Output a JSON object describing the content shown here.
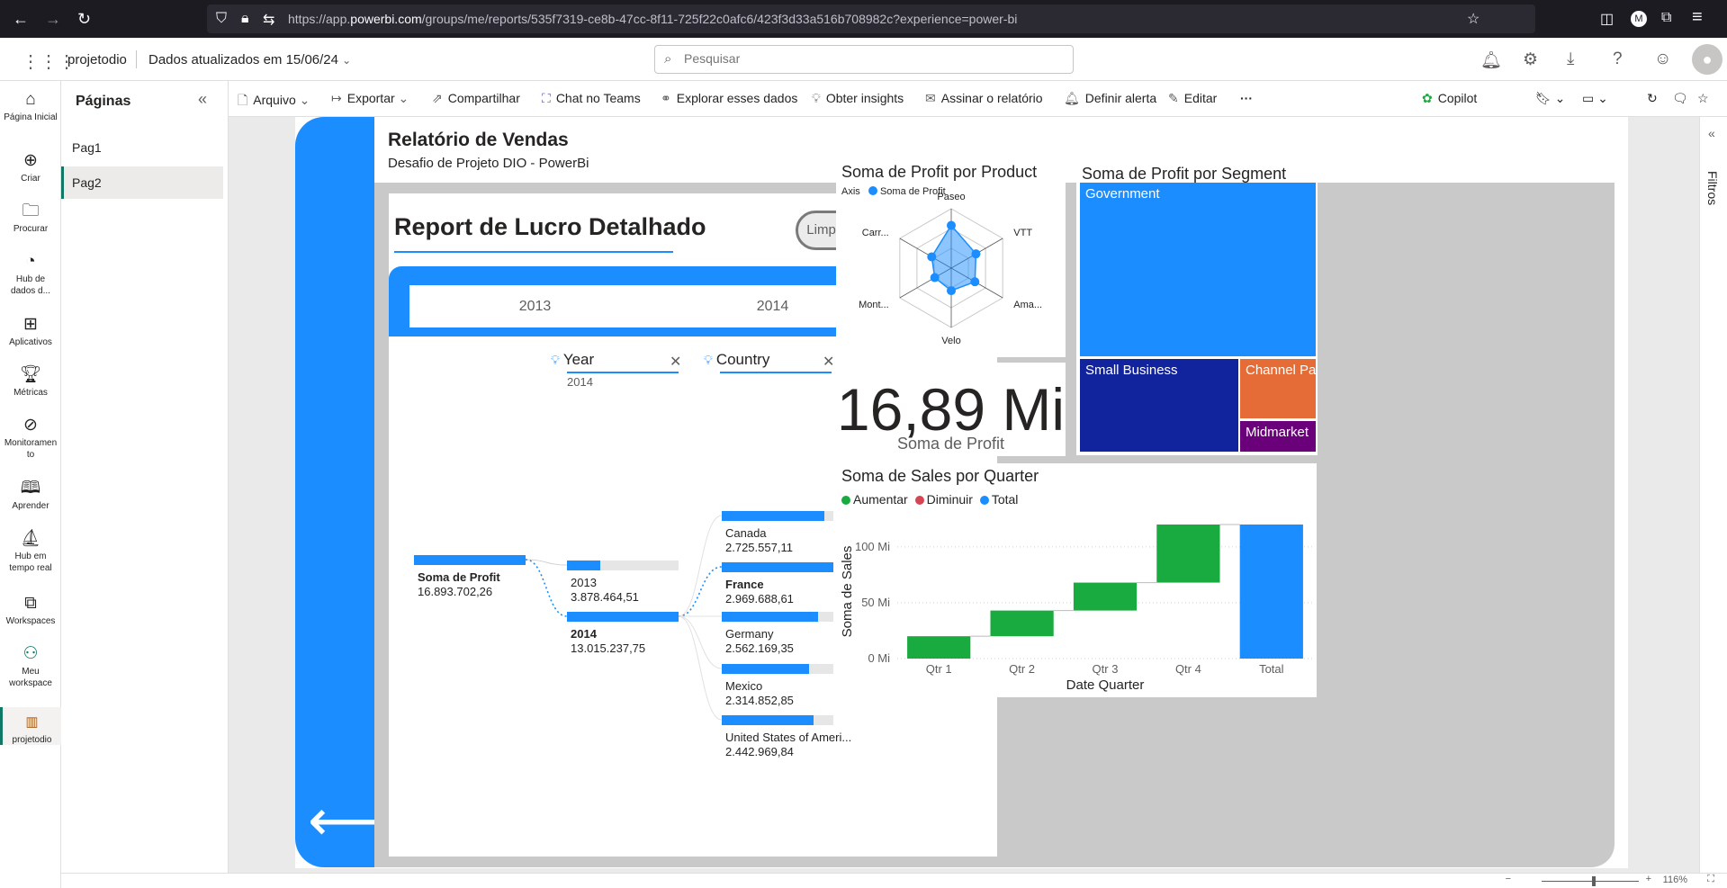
{
  "browser": {
    "url_prefix": "https://app.",
    "url_domain": "powerbi.com",
    "url_suffix": "/groups/me/reports/535f7319-ce8b-47cc-8f11-725f22c0afc6/423f3d33a516b708982c?experience=power-bi",
    "profile_initial": "M"
  },
  "topbar": {
    "workspace": "projetodio",
    "updated": "Dados atualizados em 15/06/24",
    "search_placeholder": "Pesquisar"
  },
  "leftnav": {
    "items": [
      {
        "label": "Página Inicial",
        "icon": "home-icon"
      },
      {
        "label": "Criar",
        "icon": "plus-circle-icon"
      },
      {
        "label": "Procurar",
        "icon": "folder-icon"
      },
      {
        "label": "Hub de dados d...",
        "icon": "data-hub-icon"
      },
      {
        "label": "Aplicativos",
        "icon": "apps-icon"
      },
      {
        "label": "Métricas",
        "icon": "trophy-icon"
      },
      {
        "label": "Monitoramento",
        "icon": "monitor-icon"
      },
      {
        "label": "Aprender",
        "icon": "book-icon"
      },
      {
        "label": "Hub em tempo real",
        "icon": "realtime-icon"
      },
      {
        "label": "Workspaces",
        "icon": "workspaces-icon"
      },
      {
        "label": "Meu workspace",
        "icon": "person-icon"
      },
      {
        "label": "projetodio",
        "icon": "report-icon"
      }
    ]
  },
  "pages_pane": {
    "title": "Páginas",
    "pages": [
      "Pag1",
      "Pag2"
    ],
    "active": "Pag2"
  },
  "toolbar": {
    "arquivo": "Arquivo",
    "exportar": "Exportar",
    "compartilhar": "Compartilhar",
    "teams": "Chat no Teams",
    "explorar": "Explorar esses dados",
    "insights": "Obter insights",
    "assinar": "Assinar o relatório",
    "alerta": "Definir alerta",
    "editar": "Editar",
    "more": "···",
    "copilot": "Copilot"
  },
  "rightrail": {
    "filters": "Filtros"
  },
  "status": {
    "zoom": "116%"
  },
  "report": {
    "title": "Relatório de Vendas",
    "subtitle": "Desafio de Projeto DIO - PowerBi",
    "section_title": "Report de Lucro Detalhado",
    "clear_button": "Limpar Dados",
    "year_slicer": [
      "2013",
      "2014"
    ],
    "decomposition": {
      "levels": [
        {
          "label": "Year",
          "selected": "2014"
        },
        {
          "label": "Country",
          "selected": ""
        }
      ],
      "root": {
        "name": "Soma de Profit",
        "value": "16.893.702,26"
      },
      "years": [
        {
          "name": "2013",
          "value": "3.878.464,51",
          "fraction": 0.298
        },
        {
          "name": "2014",
          "value": "13.015.237,75",
          "fraction": 1.0
        }
      ],
      "countries": [
        {
          "name": "Canada",
          "value": "2.725.557,11",
          "fraction": 0.92
        },
        {
          "name": "France",
          "value": "2.969.688,61",
          "fraction": 1.0
        },
        {
          "name": "Germany",
          "value": "2.562.169,35",
          "fraction": 0.86
        },
        {
          "name": "Mexico",
          "value": "2.314.852,85",
          "fraction": 0.78
        },
        {
          "name": "United States of Ameri...",
          "value": "2.442.969,84",
          "fraction": 0.82
        }
      ]
    },
    "kpi": {
      "value": "16,89 Mi",
      "label": "Soma de Profit"
    }
  },
  "colors": {
    "accent": "#1b8dff",
    "increase": "#1aab40",
    "decrease": "#d64554",
    "total": "#1b8dff",
    "government": "#1b8dff",
    "small_business": "#12239e",
    "channel_partners": "#e66c37",
    "midmarket": "#6b007b"
  },
  "chart_data": [
    {
      "type": "radar",
      "title": "Soma de Profit por Product",
      "legend_title": "Axis",
      "series": [
        {
          "name": "Soma de Profit"
        }
      ],
      "categories": [
        "Paseo",
        "VTT",
        "Ama...",
        "Velo",
        "Mont...",
        "Carr..."
      ],
      "values_fraction": [
        0.72,
        0.48,
        0.46,
        0.38,
        0.32,
        0.38
      ]
    },
    {
      "type": "treemap",
      "title": "Soma de Profit por Segment",
      "categories": [
        "Government",
        "Small Business",
        "Channel Pa...",
        "Midmarket"
      ],
      "values": [
        11.4,
        4.1,
        1.1,
        0.6
      ],
      "unit": "Mi (estimated)"
    },
    {
      "type": "waterfall",
      "title": "Soma de Sales por Quarter",
      "legend": [
        "Aumentar",
        "Diminuir",
        "Total"
      ],
      "categories": [
        "Qtr 1",
        "Qtr 2",
        "Qtr 3",
        "Qtr 4",
        "Total"
      ],
      "values": [
        20,
        23,
        25,
        52,
        120
      ],
      "xlabel": "Date Quarter",
      "ylabel": "Soma de Sales",
      "ylim": [
        0,
        120
      ],
      "yticks": [
        "0 Mi",
        "50 Mi",
        "100 Mi"
      ],
      "ytick_values": [
        0,
        50,
        100
      ]
    }
  ]
}
